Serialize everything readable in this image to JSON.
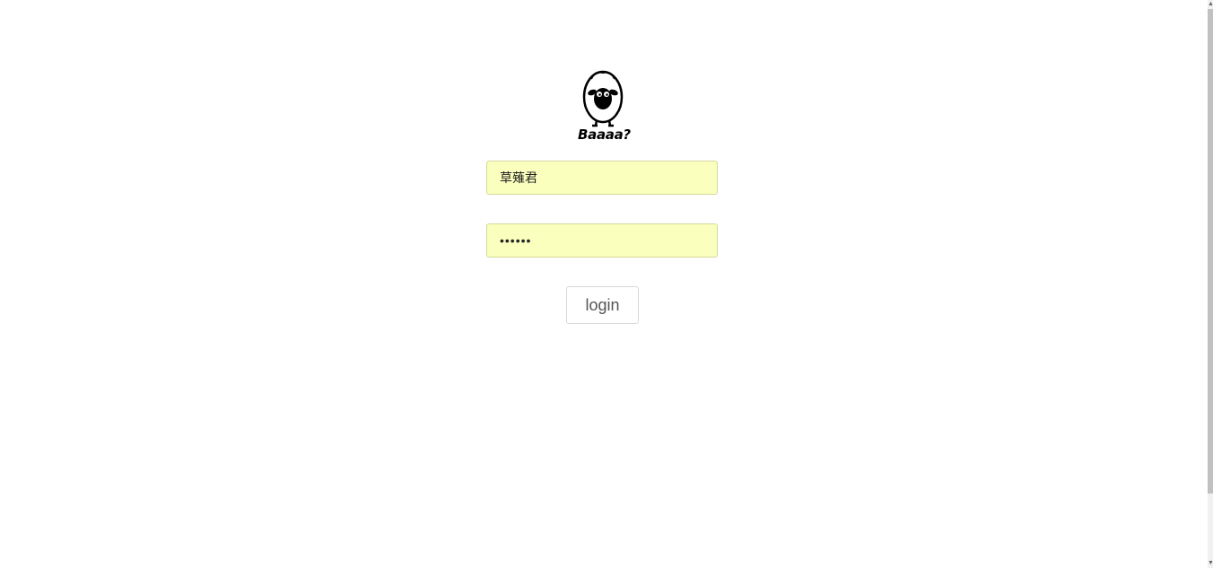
{
  "logo": {
    "text": "Baaaa?",
    "icon": "sheep-icon"
  },
  "form": {
    "username_value": "草薙君",
    "password_value": "••••••",
    "login_label": "login"
  },
  "colors": {
    "autofill_background": "#faffbd",
    "button_text": "#555555",
    "button_border": "#d9d9d9"
  }
}
